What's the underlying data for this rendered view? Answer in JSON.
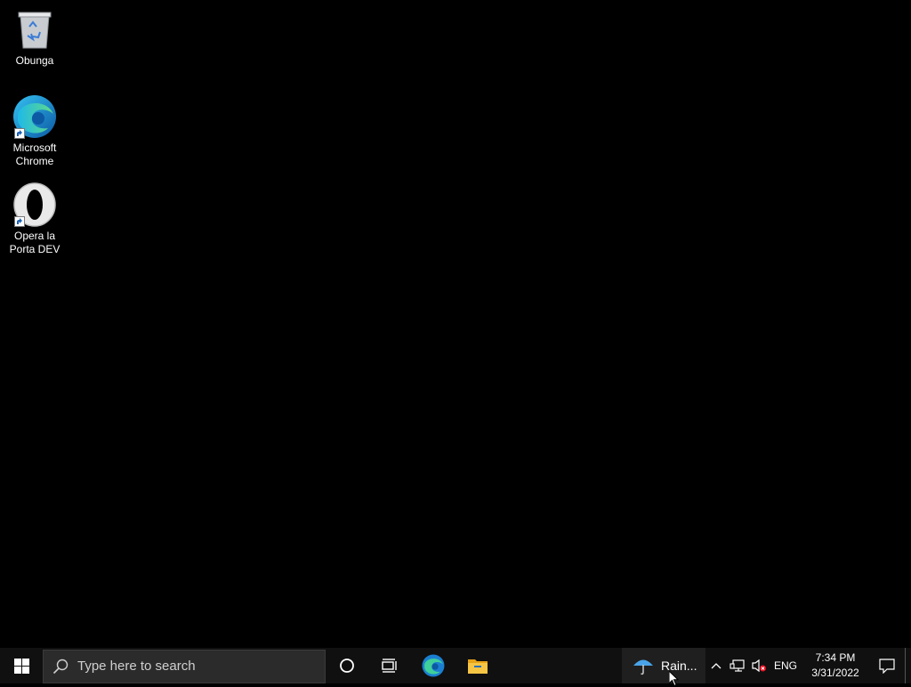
{
  "desktop": {
    "icons": [
      {
        "label": "Obunga",
        "icon": "recycle-bin-icon"
      },
      {
        "label": "Microsoft\nChrome",
        "icon": "edge-browser-icon"
      },
      {
        "label": "Opera la\nPorta DEV",
        "icon": "opera-browser-icon"
      }
    ]
  },
  "taskbar": {
    "search_placeholder": "Type here to search",
    "pinned": [
      "edge-browser-icon",
      "file-explorer-icon"
    ],
    "weather_text": "Rain...",
    "language": "ENG",
    "time": "7:34 PM",
    "date": "3/31/2022"
  },
  "colors": {
    "desktop_bg": "#000000",
    "taskbar_bg": "#101010",
    "search_bg": "#2b2b2b",
    "start_icon": "#ffffff",
    "folder_yellow": "#f6c544"
  }
}
